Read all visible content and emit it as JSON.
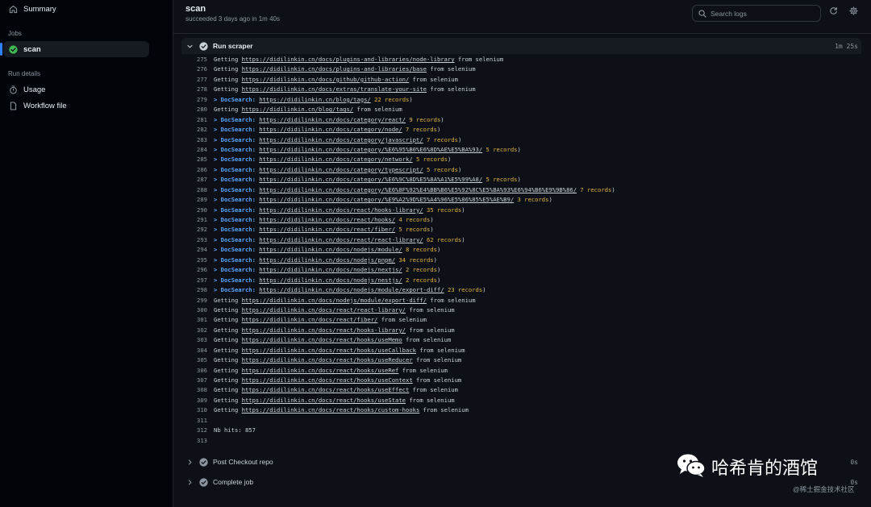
{
  "sidebar": {
    "summary_label": "Summary",
    "jobs_heading": "Jobs",
    "job_label": "scan",
    "run_details_heading": "Run details",
    "usage_label": "Usage",
    "workflow_label": "Workflow file"
  },
  "header": {
    "title": "scan",
    "subtitle": "succeeded 3 days ago in 1m 40s",
    "search_placeholder": "Search logs"
  },
  "steps": [
    {
      "title": "Run scraper",
      "duration": "1m 25s",
      "expanded": true
    },
    {
      "title": "Post Checkout repo",
      "duration": "0s",
      "expanded": false
    },
    {
      "title": "Complete job",
      "duration": "0s",
      "expanded": false
    }
  ],
  "log_lines": [
    {
      "n": "275",
      "kind": "get",
      "url": "https://didilinkin.cn/docs/plugins-and-libraries/node-library"
    },
    {
      "n": "276",
      "kind": "get",
      "url": "https://didilinkin.cn/docs/plugins-and-libraries/base"
    },
    {
      "n": "277",
      "kind": "get",
      "url": "https://didilinkin.cn/docs/github/github-action/"
    },
    {
      "n": "278",
      "kind": "get",
      "url": "https://didilinkin.cn/docs/extras/translate-your-site"
    },
    {
      "n": "279",
      "kind": "doc",
      "url": "https://didilinkin.cn/blog/tags/",
      "count": "22 records"
    },
    {
      "n": "280",
      "kind": "get",
      "url": "https://didilinkin.cn/blog/tags/"
    },
    {
      "n": "281",
      "kind": "doc",
      "url": "https://didilinkin.cn/docs/category/react/",
      "count": "9 records"
    },
    {
      "n": "282",
      "kind": "doc",
      "url": "https://didilinkin.cn/docs/category/node/",
      "count": "7 records"
    },
    {
      "n": "283",
      "kind": "doc",
      "url": "https://didilinkin.cn/docs/category/javascript/",
      "count": "7 records"
    },
    {
      "n": "284",
      "kind": "doc",
      "url": "https://didilinkin.cn/docs/category/%E6%95%B0%E6%8D%AE%E5%BA%93/",
      "count": "5 records"
    },
    {
      "n": "285",
      "kind": "doc",
      "url": "https://didilinkin.cn/docs/category/network/",
      "count": "5 records"
    },
    {
      "n": "286",
      "kind": "doc",
      "url": "https://didilinkin.cn/docs/category/typescript/",
      "count": "5 records"
    },
    {
      "n": "287",
      "kind": "doc",
      "url": "https://didilinkin.cn/docs/category/%E6%9C%8D%E5%8A%A1%E5%99%A8/",
      "count": "5 records"
    },
    {
      "n": "288",
      "kind": "doc",
      "url": "https://didilinkin.cn/docs/category/%E6%8F%92%E4%BB%B6%E5%92%8C%E5%BA%93%E6%94%B6%E9%9B%86/",
      "count": "7 records"
    },
    {
      "n": "289",
      "kind": "doc",
      "url": "https://didilinkin.cn/docs/category/%E9%A2%9D%E5%A4%96%E5%86%85%E5%AE%B9/",
      "count": "3 records"
    },
    {
      "n": "290",
      "kind": "doc",
      "url": "https://didilinkin.cn/docs/react/hooks-library/",
      "count": "35 records"
    },
    {
      "n": "291",
      "kind": "doc",
      "url": "https://didilinkin.cn/docs/react/hooks/",
      "count": "4 records"
    },
    {
      "n": "292",
      "kind": "doc",
      "url": "https://didilinkin.cn/docs/react/fiber/",
      "count": "5 records"
    },
    {
      "n": "293",
      "kind": "doc",
      "url": "https://didilinkin.cn/docs/react/react-library/",
      "count": "62 records"
    },
    {
      "n": "294",
      "kind": "doc",
      "url": "https://didilinkin.cn/docs/nodejs/module/",
      "count": "8 records"
    },
    {
      "n": "295",
      "kind": "doc",
      "url": "https://didilinkin.cn/docs/nodejs/pnpm/",
      "count": "34 records"
    },
    {
      "n": "296",
      "kind": "doc",
      "url": "https://didilinkin.cn/docs/nodejs/nextjs/",
      "count": "2 records"
    },
    {
      "n": "297",
      "kind": "doc",
      "url": "https://didilinkin.cn/docs/nodejs/nestjs/",
      "count": "2 records"
    },
    {
      "n": "298",
      "kind": "doc",
      "url": "https://didilinkin.cn/docs/nodejs/module/export-diff/",
      "count": "23 records"
    },
    {
      "n": "299",
      "kind": "get",
      "url": "https://didilinkin.cn/docs/nodejs/module/export-diff/"
    },
    {
      "n": "300",
      "kind": "get",
      "url": "https://didilinkin.cn/docs/react/react-library/"
    },
    {
      "n": "301",
      "kind": "get",
      "url": "https://didilinkin.cn/docs/react/fiber/"
    },
    {
      "n": "302",
      "kind": "get",
      "url": "https://didilinkin.cn/docs/react/hooks-library/"
    },
    {
      "n": "303",
      "kind": "get",
      "url": "https://didilinkin.cn/docs/react/hooks/useMemo"
    },
    {
      "n": "304",
      "kind": "get",
      "url": "https://didilinkin.cn/docs/react/hooks/useCallback"
    },
    {
      "n": "305",
      "kind": "get",
      "url": "https://didilinkin.cn/docs/react/hooks/useReducer"
    },
    {
      "n": "306",
      "kind": "get",
      "url": "https://didilinkin.cn/docs/react/hooks/useRef"
    },
    {
      "n": "307",
      "kind": "get",
      "url": "https://didilinkin.cn/docs/react/hooks/useContext"
    },
    {
      "n": "308",
      "kind": "get",
      "url": "https://didilinkin.cn/docs/react/hooks/useEffect"
    },
    {
      "n": "309",
      "kind": "get",
      "url": "https://didilinkin.cn/docs/react/hooks/useState"
    },
    {
      "n": "310",
      "kind": "get",
      "url": "https://didilinkin.cn/docs/react/hooks/custom-hooks"
    },
    {
      "n": "311",
      "kind": "text",
      "text": ""
    },
    {
      "n": "312",
      "kind": "text",
      "text": "Nb hits: 857"
    },
    {
      "n": "313",
      "kind": "text",
      "text": ""
    }
  ],
  "log_words": {
    "getting": "Getting",
    "from_selenium": "from selenium",
    "docsearch": "> DocSearch:"
  },
  "watermark": {
    "title": "哈希肯的酒馆",
    "credit": "@稀土掘金技术社区"
  },
  "colors": {
    "background": "#010409",
    "panel": "#0d1117",
    "success": "#3fb950",
    "accent": "#2f81f7",
    "docsearch": "#58a6ff",
    "records": "#e3b341"
  },
  "icons": [
    "home-icon",
    "check-circle-icon",
    "stopwatch-icon",
    "file-icon",
    "search-icon",
    "refresh-icon",
    "gear-icon",
    "chevron-down-icon",
    "chevron-right-icon",
    "wechat-icon"
  ]
}
